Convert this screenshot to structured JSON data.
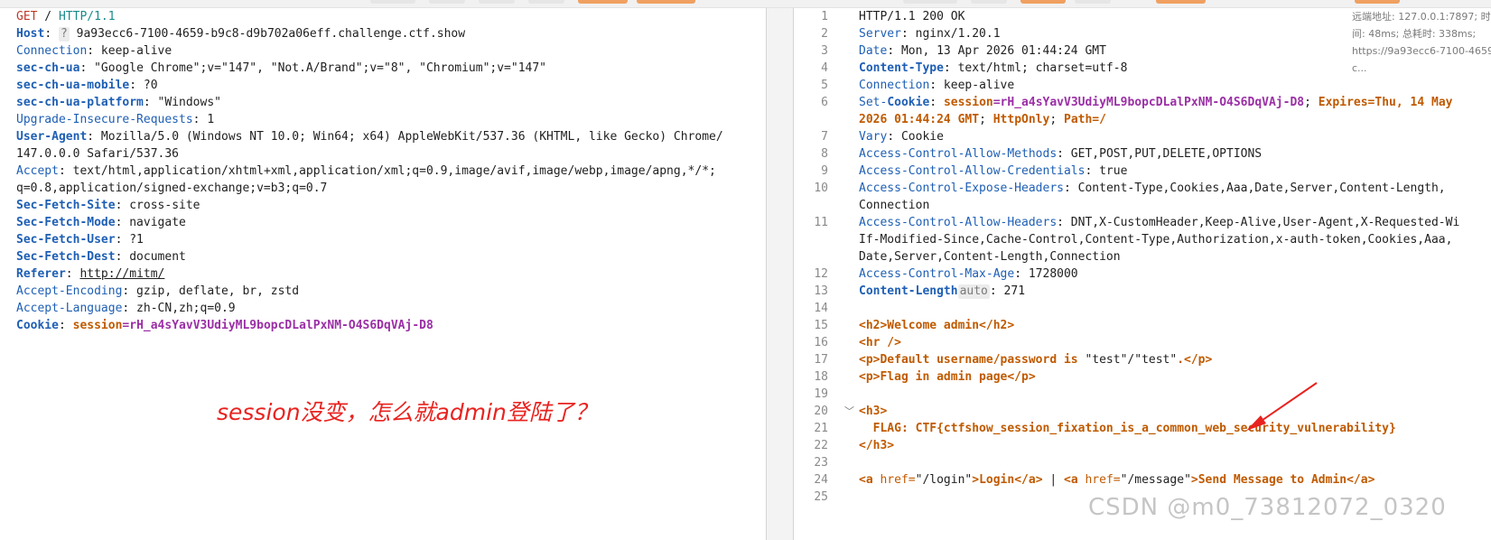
{
  "request": {
    "lines": [
      [
        {
          "t": "GET",
          "c": "meth"
        },
        {
          "t": " / ",
          "c": "val"
        },
        {
          "t": "HTTP/1.1",
          "c": "ver"
        }
      ],
      [
        {
          "t": "Host",
          "c": "nm"
        },
        {
          "t": ": ",
          "c": "val"
        },
        {
          "t": "?",
          "c": "pill"
        },
        {
          "t": " 9a93ecc6-7100-4659-b9c8-d9b702a06eff.challenge.ctf.show",
          "c": "val"
        }
      ],
      [
        {
          "t": "Connection",
          "c": "nmp"
        },
        {
          "t": ": keep-alive",
          "c": "val"
        }
      ],
      [
        {
          "t": "sec-ch-ua",
          "c": "nm"
        },
        {
          "t": ": \"Google Chrome\";v=\"147\", \"Not.A/Brand\";v=\"8\", \"Chromium\";v=\"147\"",
          "c": "val"
        }
      ],
      [
        {
          "t": "sec-ch-ua-mobile",
          "c": "nm"
        },
        {
          "t": ": ?0",
          "c": "val"
        }
      ],
      [
        {
          "t": "sec-ch-ua-platform",
          "c": "nm"
        },
        {
          "t": ": \"Windows\"",
          "c": "val"
        }
      ],
      [
        {
          "t": "Upgrade-Insecure-Requests",
          "c": "nmp"
        },
        {
          "t": ": 1",
          "c": "val"
        }
      ],
      [
        {
          "t": "User-Agent",
          "c": "nm"
        },
        {
          "t": ": Mozilla/5.0 (Windows NT 10.0; Win64; x64) AppleWebKit/537.36 (KHTML, like Gecko) Chrome/",
          "c": "val"
        }
      ],
      [
        {
          "t": "147.0.0.0 Safari/537.36",
          "c": "val"
        }
      ],
      [
        {
          "t": "Accept",
          "c": "nmp"
        },
        {
          "t": ": text/html,application/xhtml+xml,application/xml;q=0.9,image/avif,image/webp,image/apng,*/*;",
          "c": "val"
        }
      ],
      [
        {
          "t": "q=0.8,application/signed-exchange;v=b3;q=0.7",
          "c": "val"
        }
      ],
      [
        {
          "t": "Sec-Fetch-Site",
          "c": "nm"
        },
        {
          "t": ": cross-site",
          "c": "val"
        }
      ],
      [
        {
          "t": "Sec-Fetch-Mode",
          "c": "nm"
        },
        {
          "t": ": navigate",
          "c": "val"
        }
      ],
      [
        {
          "t": "Sec-Fetch-User",
          "c": "nm"
        },
        {
          "t": ": ?1",
          "c": "val"
        }
      ],
      [
        {
          "t": "Sec-Fetch-Dest",
          "c": "nm"
        },
        {
          "t": ": document",
          "c": "val"
        }
      ],
      [
        {
          "t": "Referer",
          "c": "nm"
        },
        {
          "t": ": ",
          "c": "val"
        },
        {
          "t": "http://mitm/",
          "c": "link"
        }
      ],
      [
        {
          "t": "Accept-Encoding",
          "c": "nmp"
        },
        {
          "t": ": gzip, deflate, br, zstd",
          "c": "val"
        }
      ],
      [
        {
          "t": "Accept-Language",
          "c": "nmp"
        },
        {
          "t": ": zh-CN,zh;q=0.9",
          "c": "val"
        }
      ],
      [
        {
          "t": "Cookie",
          "c": "nm"
        },
        {
          "t": ": ",
          "c": "val"
        },
        {
          "t": "session",
          "c": "ck"
        },
        {
          "t": "=rH_a4sYavV3UdiyML9bopcDLalPxNM-O4S6DqVAj-D8",
          "c": "ckv"
        }
      ]
    ]
  },
  "annotation": "session没变，怎么就admin登陆了？",
  "response": {
    "lines": [
      {
        "n": "1",
        "parts": [
          {
            "t": "HTTP/1.1 200 OK",
            "c": "val"
          }
        ]
      },
      {
        "n": "2",
        "parts": [
          {
            "t": "Server",
            "c": "nmp"
          },
          {
            "t": ": nginx/1.20.1",
            "c": "val"
          }
        ]
      },
      {
        "n": "3",
        "parts": [
          {
            "t": "Date",
            "c": "nmp"
          },
          {
            "t": ": Mon, 13 Apr 2026 01:44:24 GMT",
            "c": "val"
          }
        ]
      },
      {
        "n": "4",
        "parts": [
          {
            "t": "Content-Type",
            "c": "nm"
          },
          {
            "t": ": text/html; charset=utf-8",
            "c": "val"
          }
        ]
      },
      {
        "n": "5",
        "parts": [
          {
            "t": "Connection",
            "c": "nmp"
          },
          {
            "t": ": keep-alive",
            "c": "val"
          }
        ]
      },
      {
        "n": "6",
        "parts": [
          {
            "t": "Set-",
            "c": "nmp"
          },
          {
            "t": "Cookie",
            "c": "nm"
          },
          {
            "t": ": ",
            "c": "val"
          },
          {
            "t": "session",
            "c": "ck"
          },
          {
            "t": "=rH_a4sYavV3UdiyML9bopcDLalPxNM-O4S6DqVAj-D8",
            "c": "ckv"
          },
          {
            "t": "; ",
            "c": "val"
          },
          {
            "t": "Expires=Thu, 14 May",
            "c": "ck"
          }
        ]
      },
      {
        "n": "",
        "parts": [
          {
            "t": "2026 01:44:24 GMT",
            "c": "ck"
          },
          {
            "t": "; ",
            "c": "val"
          },
          {
            "t": "HttpOnly",
            "c": "ck"
          },
          {
            "t": "; ",
            "c": "val"
          },
          {
            "t": "Path=/",
            "c": "ck"
          }
        ]
      },
      {
        "n": "7",
        "parts": [
          {
            "t": "Vary",
            "c": "nmp"
          },
          {
            "t": ": Cookie",
            "c": "val"
          }
        ]
      },
      {
        "n": "8",
        "parts": [
          {
            "t": "Access-Control-Allow-Methods",
            "c": "nmp"
          },
          {
            "t": ": GET,POST,PUT,DELETE,OPTIONS",
            "c": "val"
          }
        ]
      },
      {
        "n": "9",
        "parts": [
          {
            "t": "Access-Control-Allow-Credentials",
            "c": "nmp"
          },
          {
            "t": ": true",
            "c": "val"
          }
        ]
      },
      {
        "n": "10",
        "parts": [
          {
            "t": "Access-Control-Expose-Headers",
            "c": "nmp"
          },
          {
            "t": ": Content-Type,Cookies,Aaa,Date,Server,Content-Length,",
            "c": "val"
          }
        ]
      },
      {
        "n": "",
        "parts": [
          {
            "t": "Connection",
            "c": "val"
          }
        ]
      },
      {
        "n": "11",
        "parts": [
          {
            "t": "Access-Control-Allow-Headers",
            "c": "nmp"
          },
          {
            "t": ": DNT,X-CustomHeader,Keep-Alive,User-Agent,X-Requested-Wi",
            "c": "val"
          }
        ]
      },
      {
        "n": "",
        "parts": [
          {
            "t": "If-Modified-Since,Cache-Control,Content-Type,Authorization,x-auth-token,Cookies,Aaa,",
            "c": "val"
          }
        ]
      },
      {
        "n": "",
        "parts": [
          {
            "t": "Date,Server,Content-Length,Connection",
            "c": "val"
          }
        ]
      },
      {
        "n": "12",
        "parts": [
          {
            "t": "Access-Control-Max-Age",
            "c": "nmp"
          },
          {
            "t": ": 1728000",
            "c": "val"
          }
        ]
      },
      {
        "n": "13",
        "parts": [
          {
            "t": "Content-Length",
            "c": "nm"
          },
          {
            "t": "auto",
            "c": "pill"
          },
          {
            "t": ": 271",
            "c": "val"
          }
        ]
      },
      {
        "n": "14",
        "parts": []
      },
      {
        "n": "15",
        "parts": [
          {
            "t": "<h2>Welcome admin</h2>",
            "c": "tag"
          }
        ]
      },
      {
        "n": "16",
        "parts": [
          {
            "t": "<hr />",
            "c": "tag"
          }
        ]
      },
      {
        "n": "17",
        "parts": [
          {
            "t": "<p>Default username/password is ",
            "c": "tag"
          },
          {
            "t": "\"test\"/\"test\"",
            "c": "str"
          },
          {
            "t": ".</p>",
            "c": "tag"
          }
        ]
      },
      {
        "n": "18",
        "parts": [
          {
            "t": "<p>Flag in admin page</p>",
            "c": "tag"
          }
        ]
      },
      {
        "n": "19",
        "parts": []
      },
      {
        "n": "20",
        "parts": [
          {
            "t": "<h3>",
            "c": "tag"
          }
        ],
        "fold": "﹀"
      },
      {
        "n": "21",
        "parts": [
          {
            "t": "  FLAG: CTF{ctfshow_session_fixation_is_a_common_web_security_vulnerability}",
            "c": "tag"
          }
        ]
      },
      {
        "n": "22",
        "parts": [
          {
            "t": "</h3>",
            "c": "tag"
          }
        ]
      },
      {
        "n": "23",
        "parts": []
      },
      {
        "n": "24",
        "parts": [
          {
            "t": "<a ",
            "c": "tag"
          },
          {
            "t": "href=",
            "c": "attr"
          },
          {
            "t": "\"/login\"",
            "c": "str"
          },
          {
            "t": ">Login</a> ",
            "c": "tag"
          },
          {
            "t": "| ",
            "c": "val"
          },
          {
            "t": "<a ",
            "c": "tag"
          },
          {
            "t": "href=",
            "c": "attr"
          },
          {
            "t": "\"/message\"",
            "c": "str"
          },
          {
            "t": ">Send Message to Admin</a>",
            "c": "tag"
          }
        ]
      },
      {
        "n": "25",
        "parts": []
      }
    ]
  },
  "info_panel": [
    "远端地址: 127.0.0.1:7897; 时",
    "间: 48ms; 总耗时: 338ms;",
    "https://9a93ecc6-7100-4659",
    "c..."
  ],
  "watermark": "CSDN @m0_73812072_0320",
  "colors": {
    "annotation": "#e8231f",
    "toolbar_accent": "#f0a060"
  }
}
